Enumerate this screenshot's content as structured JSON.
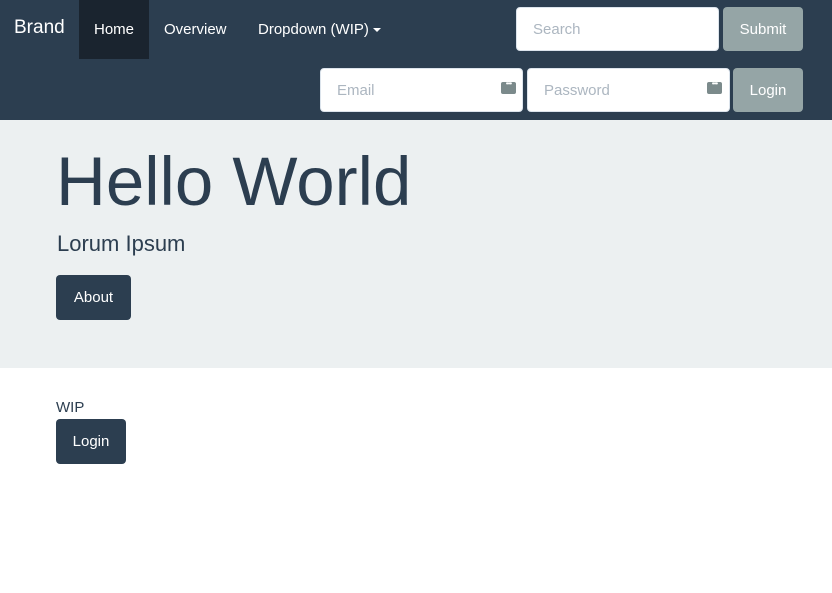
{
  "navbar": {
    "brand": "Brand",
    "items": [
      {
        "label": "Home",
        "active": true
      },
      {
        "label": "Overview",
        "active": false
      },
      {
        "label": "Dropdown (WIP)",
        "active": false
      }
    ],
    "search": {
      "placeholder": "Search",
      "value": ""
    },
    "submit_label": "Submit",
    "email": {
      "placeholder": "Email",
      "value": ""
    },
    "password": {
      "placeholder": "Password",
      "value": ""
    },
    "login_label": "Login"
  },
  "hero": {
    "title": "Hello World",
    "subtitle": "Lorum Ipsum",
    "button_label": "About"
  },
  "content": {
    "wip_text": "WIP",
    "login_label": "Login"
  },
  "colors": {
    "navbar": "#2c3e50",
    "active_nav": "#1a242f",
    "jumbotron": "#ecf0f1",
    "primary_button": "#2c3e50",
    "secondary_button": "#95a5a6"
  },
  "icons": {
    "email_field": "password-key-icon",
    "password_field": "password-key-icon",
    "dropdown": "caret-down-icon"
  }
}
